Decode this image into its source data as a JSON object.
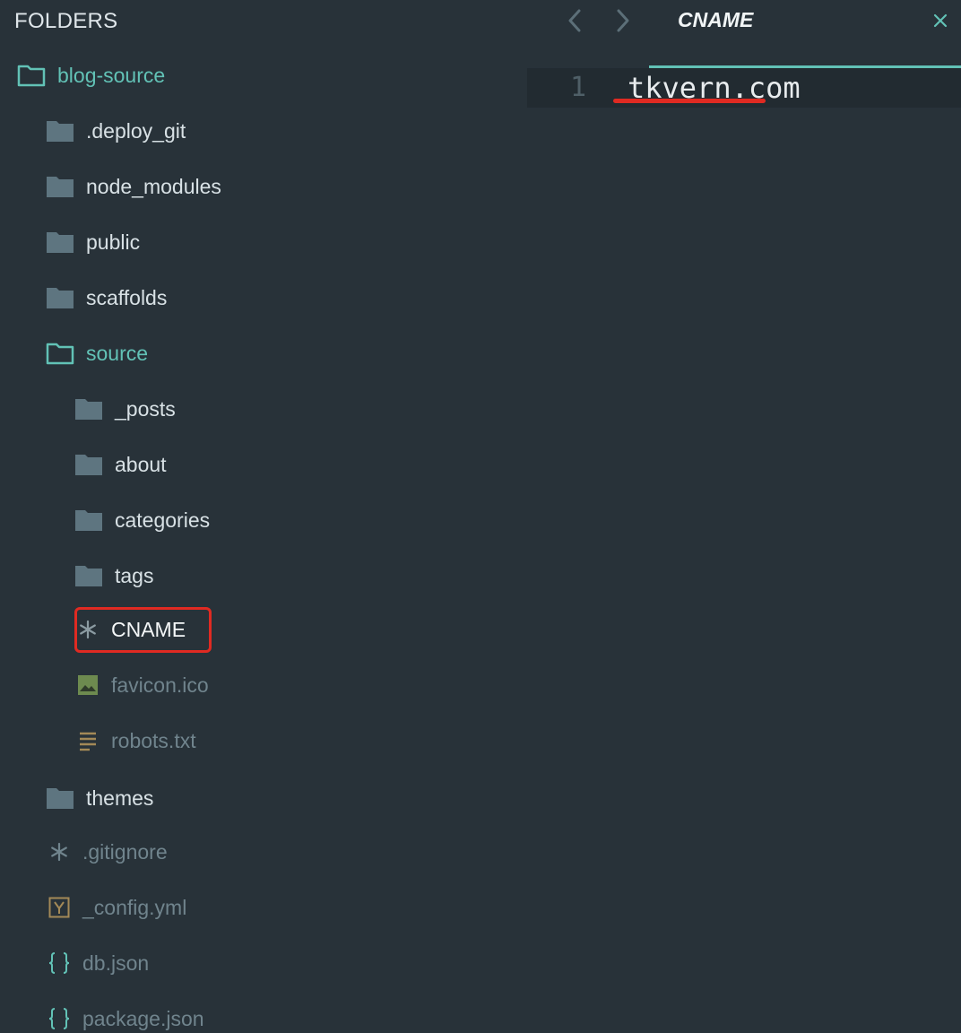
{
  "sidebar": {
    "header": "FOLDERS",
    "items": [
      {
        "label": "blog-source",
        "icon": "folder-open-icon"
      },
      {
        "label": ".deploy_git",
        "icon": "folder-icon"
      },
      {
        "label": "node_modules",
        "icon": "folder-icon"
      },
      {
        "label": "public",
        "icon": "folder-icon"
      },
      {
        "label": "scaffolds",
        "icon": "folder-icon"
      },
      {
        "label": "source",
        "icon": "folder-open-icon"
      },
      {
        "label": "_posts",
        "icon": "folder-icon"
      },
      {
        "label": "about",
        "icon": "folder-icon"
      },
      {
        "label": "categories",
        "icon": "folder-icon"
      },
      {
        "label": "tags",
        "icon": "folder-icon"
      },
      {
        "label": "CNAME",
        "icon": "asterisk-icon"
      },
      {
        "label": "favicon.ico",
        "icon": "image-file-icon"
      },
      {
        "label": "robots.txt",
        "icon": "text-file-icon"
      },
      {
        "label": "themes",
        "icon": "folder-icon"
      },
      {
        "label": ".gitignore",
        "icon": "asterisk-icon"
      },
      {
        "label": "_config.yml",
        "icon": "yaml-file-icon"
      },
      {
        "label": "db.json",
        "icon": "json-file-icon"
      },
      {
        "label": "package.json",
        "icon": "json-file-icon"
      }
    ]
  },
  "editor": {
    "tab_title": "CNAME",
    "lines": [
      {
        "number": "1",
        "text": "tkvern.com"
      }
    ]
  },
  "colors": {
    "background": "#283239",
    "accent": "#62c2b6",
    "annotation_red": "#e02a22"
  }
}
